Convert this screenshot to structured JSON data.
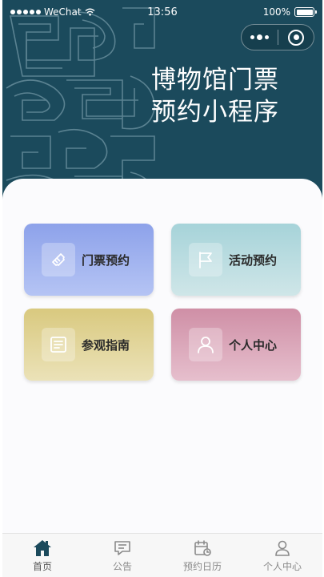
{
  "status_bar": {
    "carrier": "WeChat",
    "time": "13:56",
    "battery": "100%"
  },
  "header": {
    "title_line1": "博物馆门票",
    "title_line2": "预约小程序"
  },
  "tiles": [
    {
      "label": "门票预约",
      "icon": "ticket-icon"
    },
    {
      "label": "活动预约",
      "icon": "flag-icon"
    },
    {
      "label": "参观指南",
      "icon": "guide-icon"
    },
    {
      "label": "个人中心",
      "icon": "person-icon"
    }
  ],
  "tabbar": [
    {
      "label": "首页",
      "icon": "home-icon",
      "active": true
    },
    {
      "label": "公告",
      "icon": "notice-icon",
      "active": false
    },
    {
      "label": "预约日历",
      "icon": "calendar-icon",
      "active": false
    },
    {
      "label": "个人中心",
      "icon": "user-icon",
      "active": false
    }
  ],
  "colors": {
    "header_bg": "#1b4a5c",
    "tile_ticket": "#8da2ea",
    "tile_activity": "#a6d3d9",
    "tile_guide": "#d9c97f",
    "tile_profile": "#cf8fa6",
    "tab_active": "#1b4a5c"
  }
}
